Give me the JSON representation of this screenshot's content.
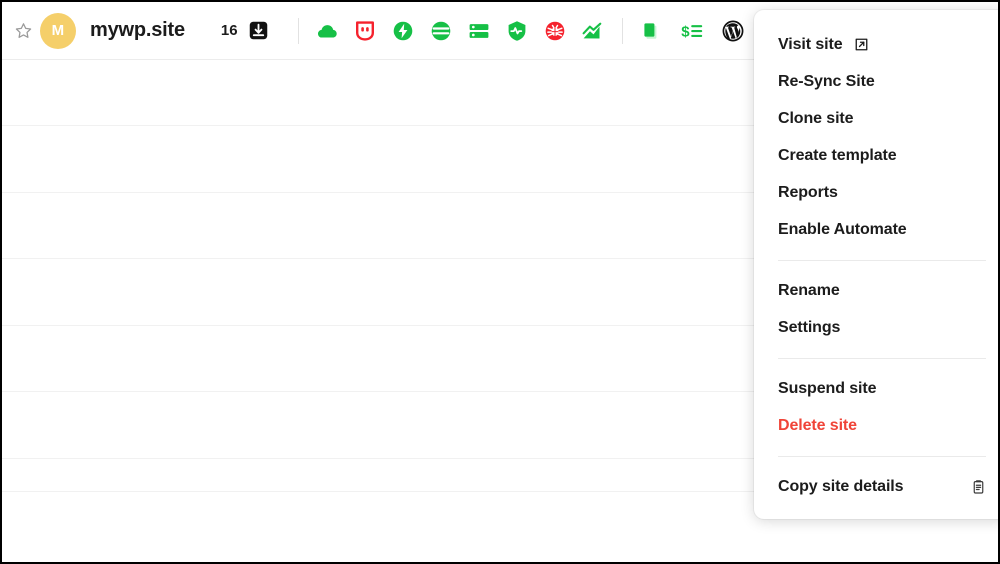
{
  "site_row": {
    "favorite_icon": "star-outline-icon",
    "avatar_initial": "M",
    "site_name": "mywp.site",
    "update_count": "16",
    "download_icon": "download-box-icon",
    "primary_icons": [
      {
        "name": "cloud-icon",
        "color": "#16c046"
      },
      {
        "name": "shield-hat-icon",
        "color": "#f5222d"
      },
      {
        "name": "lightning-bolt-circle-icon",
        "color": "#16c046"
      },
      {
        "name": "hamburger-circle-icon",
        "color": "#16c046"
      },
      {
        "name": "server-rack-icon",
        "color": "#16c046"
      },
      {
        "name": "heartbeat-shield-icon",
        "color": "#16c046"
      },
      {
        "name": "bug-circle-icon",
        "color": "#f5222d"
      },
      {
        "name": "trending-up-icon",
        "color": "#16c046"
      }
    ],
    "secondary_icons": [
      {
        "name": "copy-pages-icon",
        "color": "#16c046"
      },
      {
        "name": "billing-list-icon",
        "color": "#16c046"
      },
      {
        "name": "wordpress-icon",
        "color": "#111111"
      }
    ]
  },
  "menu": {
    "groups": [
      {
        "items": [
          {
            "label": "Visit site",
            "icon": "external-link-icon",
            "icon_position": "inline",
            "danger": false
          },
          {
            "label": "Re-Sync Site",
            "icon": null,
            "danger": false
          },
          {
            "label": "Clone site",
            "icon": null,
            "danger": false
          },
          {
            "label": "Create template",
            "icon": null,
            "danger": false
          },
          {
            "label": "Reports",
            "icon": null,
            "danger": false
          },
          {
            "label": "Enable Automate",
            "icon": null,
            "danger": false
          }
        ]
      },
      {
        "items": [
          {
            "label": "Rename",
            "icon": null,
            "danger": false
          },
          {
            "label": "Settings",
            "icon": null,
            "danger": false
          }
        ]
      },
      {
        "items": [
          {
            "label": "Suspend site",
            "icon": null,
            "danger": false
          },
          {
            "label": "Delete site",
            "icon": null,
            "danger": true
          }
        ]
      },
      {
        "items": [
          {
            "label": "Copy site details",
            "icon": "clipboard-icon",
            "icon_position": "trailing",
            "danger": false
          }
        ]
      }
    ]
  },
  "colors": {
    "green": "#16c046",
    "red": "#f5222d",
    "danger_text": "#f04438",
    "avatar_bg": "#f5cf6a",
    "text": "#1c1c1c"
  },
  "background_rows": {
    "line_offsets": [
      123,
      190,
      256,
      323,
      389,
      456,
      489
    ]
  }
}
